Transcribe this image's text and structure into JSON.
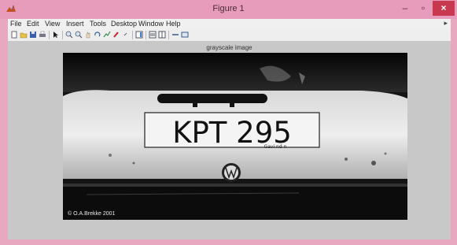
{
  "window": {
    "title": "Figure 1",
    "min_glyph": "–",
    "max_glyph": "▫",
    "close_glyph": "×"
  },
  "menu": {
    "items": [
      "File",
      "Edit",
      "View",
      "Insert",
      "Tools",
      "Desktop",
      "Window",
      "Help"
    ],
    "overflow_glyph": "▸"
  },
  "toolbar": {
    "icons": [
      "new-figure-icon",
      "open-file-icon",
      "save-icon",
      "print-icon",
      "edit-plot-icon",
      "zoom-in-icon",
      "zoom-out-icon",
      "pan-icon",
      "rotate-3d-icon",
      "data-cursor-icon",
      "brush-icon",
      "link-plot-icon",
      "insert-colorbar-icon",
      "insert-legend-icon",
      "hide-plot-tools-icon",
      "show-plot-tools-icon"
    ]
  },
  "figure": {
    "axes_title": "grayscale image",
    "plate_text": "KPT 295",
    "plate_caption": "Gavi nd n",
    "copyright": "© O.A.Brekke 2001"
  },
  "colors": {
    "title_bar": "#e79cbc",
    "close_button": "#c8394f",
    "figure_background": "#c8c8c8"
  }
}
